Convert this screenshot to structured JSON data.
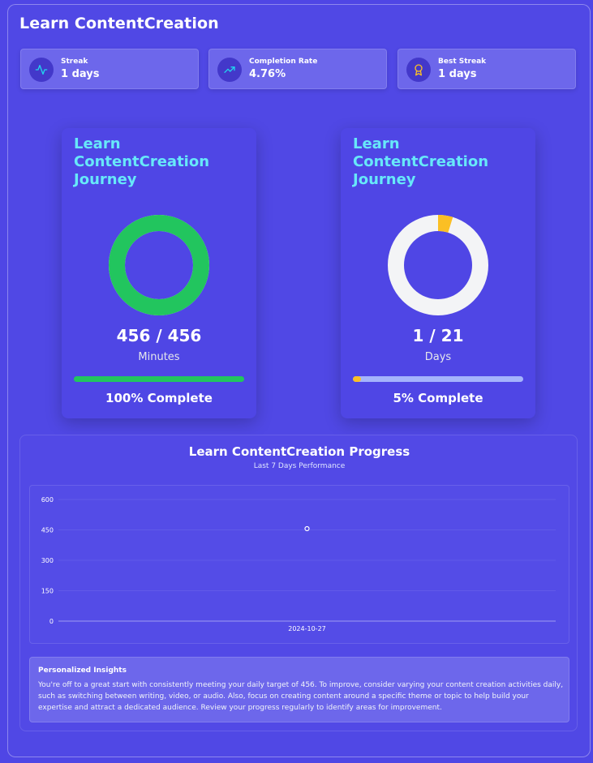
{
  "app": {
    "title": "Learn ContentCreation"
  },
  "stats": [
    {
      "label": "Streak",
      "value": "1 days",
      "icon": "activity-pulse-icon",
      "color": "#22d3ee"
    },
    {
      "label": "Completion Rate",
      "value": "4.76%",
      "icon": "trending-up-icon",
      "color": "#22d3ee"
    },
    {
      "label": "Best Streak",
      "value": "1 days",
      "icon": "award-ribbon-icon",
      "color": "#fbbf24"
    }
  ],
  "journeys": [
    {
      "title": "Learn ContentCreation Journey",
      "count": "456 / 456",
      "unit": "Minutes",
      "percent_text": "100% Complete",
      "progress": 1.0,
      "ring_color": "#22c55e",
      "track_color": "#f3f4f6",
      "bar_color": "#22c55e",
      "bar_track": "#22c55e"
    },
    {
      "title": "Learn ContentCreation Journey",
      "count": "1 / 21",
      "unit": "Days",
      "percent_text": "5% Complete",
      "progress": 0.0476,
      "ring_color": "#fbbf24",
      "track_color": "#f3f4f6",
      "bar_color": "#fbbf24",
      "bar_track": "#a5b4fc"
    }
  ],
  "progress": {
    "title": "Learn ContentCreation Progress",
    "subtitle": "Last 7 Days Performance"
  },
  "chart_data": {
    "type": "line",
    "x": [
      "2024-10-27"
    ],
    "series": [
      {
        "values": [
          456
        ]
      }
    ],
    "yticks": [
      0,
      150,
      300,
      450,
      600
    ],
    "ylim": [
      0,
      600
    ],
    "grid": true,
    "title": "",
    "xlabel": "",
    "ylabel": ""
  },
  "insights": {
    "heading": "Personalized Insights",
    "body": "You're off to a great start with consistently meeting your daily target of 456. To improve, consider varying your content creation activities daily, such as switching between writing, video, or audio. Also, focus on creating content around a specific theme or topic to help build your expertise and attract a dedicated audience. Review your progress regularly to identify areas for improvement."
  }
}
